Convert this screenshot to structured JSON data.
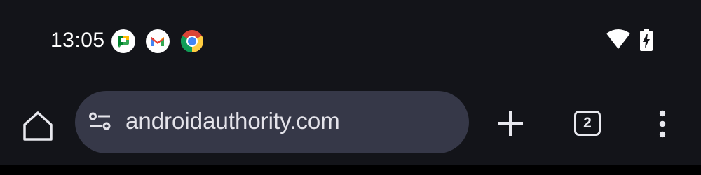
{
  "status_bar": {
    "time": "13:05",
    "notification_icons": [
      "google-chat-icon",
      "gmail-icon",
      "chrome-icon"
    ],
    "system_icons": [
      "wifi-icon",
      "battery-charging-icon"
    ]
  },
  "toolbar": {
    "home_icon": "home-icon",
    "url": "androidauthority.com",
    "page_info_icon": "tune-icon",
    "new_tab_icon": "plus-icon",
    "tab_count": "2",
    "menu_icon": "more-vert-icon"
  },
  "colors": {
    "background": "#131419",
    "omnibox": "#363848",
    "text": "#e4e3ea"
  }
}
